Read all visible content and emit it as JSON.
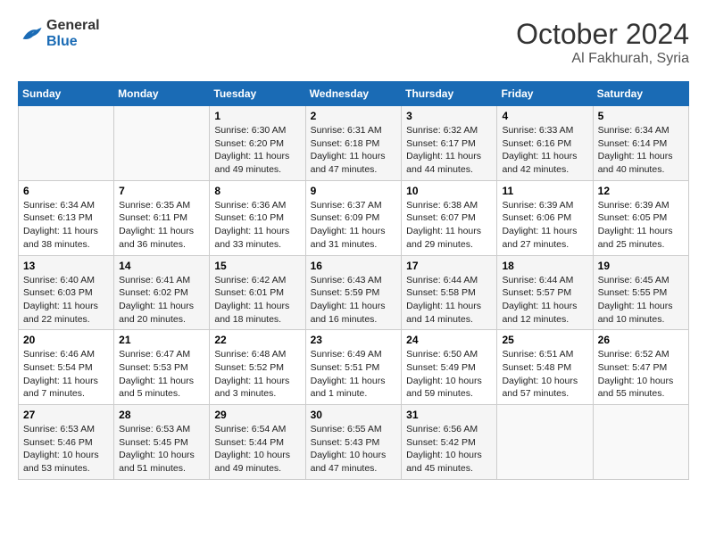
{
  "header": {
    "logo_line1": "General",
    "logo_line2": "Blue",
    "month": "October 2024",
    "location": "Al Fakhurah, Syria"
  },
  "weekdays": [
    "Sunday",
    "Monday",
    "Tuesday",
    "Wednesday",
    "Thursday",
    "Friday",
    "Saturday"
  ],
  "weeks": [
    [
      {
        "day": "",
        "info": ""
      },
      {
        "day": "",
        "info": ""
      },
      {
        "day": "1",
        "info": "Sunrise: 6:30 AM\nSunset: 6:20 PM\nDaylight: 11 hours and 49 minutes."
      },
      {
        "day": "2",
        "info": "Sunrise: 6:31 AM\nSunset: 6:18 PM\nDaylight: 11 hours and 47 minutes."
      },
      {
        "day": "3",
        "info": "Sunrise: 6:32 AM\nSunset: 6:17 PM\nDaylight: 11 hours and 44 minutes."
      },
      {
        "day": "4",
        "info": "Sunrise: 6:33 AM\nSunset: 6:16 PM\nDaylight: 11 hours and 42 minutes."
      },
      {
        "day": "5",
        "info": "Sunrise: 6:34 AM\nSunset: 6:14 PM\nDaylight: 11 hours and 40 minutes."
      }
    ],
    [
      {
        "day": "6",
        "info": "Sunrise: 6:34 AM\nSunset: 6:13 PM\nDaylight: 11 hours and 38 minutes."
      },
      {
        "day": "7",
        "info": "Sunrise: 6:35 AM\nSunset: 6:11 PM\nDaylight: 11 hours and 36 minutes."
      },
      {
        "day": "8",
        "info": "Sunrise: 6:36 AM\nSunset: 6:10 PM\nDaylight: 11 hours and 33 minutes."
      },
      {
        "day": "9",
        "info": "Sunrise: 6:37 AM\nSunset: 6:09 PM\nDaylight: 11 hours and 31 minutes."
      },
      {
        "day": "10",
        "info": "Sunrise: 6:38 AM\nSunset: 6:07 PM\nDaylight: 11 hours and 29 minutes."
      },
      {
        "day": "11",
        "info": "Sunrise: 6:39 AM\nSunset: 6:06 PM\nDaylight: 11 hours and 27 minutes."
      },
      {
        "day": "12",
        "info": "Sunrise: 6:39 AM\nSunset: 6:05 PM\nDaylight: 11 hours and 25 minutes."
      }
    ],
    [
      {
        "day": "13",
        "info": "Sunrise: 6:40 AM\nSunset: 6:03 PM\nDaylight: 11 hours and 22 minutes."
      },
      {
        "day": "14",
        "info": "Sunrise: 6:41 AM\nSunset: 6:02 PM\nDaylight: 11 hours and 20 minutes."
      },
      {
        "day": "15",
        "info": "Sunrise: 6:42 AM\nSunset: 6:01 PM\nDaylight: 11 hours and 18 minutes."
      },
      {
        "day": "16",
        "info": "Sunrise: 6:43 AM\nSunset: 5:59 PM\nDaylight: 11 hours and 16 minutes."
      },
      {
        "day": "17",
        "info": "Sunrise: 6:44 AM\nSunset: 5:58 PM\nDaylight: 11 hours and 14 minutes."
      },
      {
        "day": "18",
        "info": "Sunrise: 6:44 AM\nSunset: 5:57 PM\nDaylight: 11 hours and 12 minutes."
      },
      {
        "day": "19",
        "info": "Sunrise: 6:45 AM\nSunset: 5:55 PM\nDaylight: 11 hours and 10 minutes."
      }
    ],
    [
      {
        "day": "20",
        "info": "Sunrise: 6:46 AM\nSunset: 5:54 PM\nDaylight: 11 hours and 7 minutes."
      },
      {
        "day": "21",
        "info": "Sunrise: 6:47 AM\nSunset: 5:53 PM\nDaylight: 11 hours and 5 minutes."
      },
      {
        "day": "22",
        "info": "Sunrise: 6:48 AM\nSunset: 5:52 PM\nDaylight: 11 hours and 3 minutes."
      },
      {
        "day": "23",
        "info": "Sunrise: 6:49 AM\nSunset: 5:51 PM\nDaylight: 11 hours and 1 minute."
      },
      {
        "day": "24",
        "info": "Sunrise: 6:50 AM\nSunset: 5:49 PM\nDaylight: 10 hours and 59 minutes."
      },
      {
        "day": "25",
        "info": "Sunrise: 6:51 AM\nSunset: 5:48 PM\nDaylight: 10 hours and 57 minutes."
      },
      {
        "day": "26",
        "info": "Sunrise: 6:52 AM\nSunset: 5:47 PM\nDaylight: 10 hours and 55 minutes."
      }
    ],
    [
      {
        "day": "27",
        "info": "Sunrise: 6:53 AM\nSunset: 5:46 PM\nDaylight: 10 hours and 53 minutes."
      },
      {
        "day": "28",
        "info": "Sunrise: 6:53 AM\nSunset: 5:45 PM\nDaylight: 10 hours and 51 minutes."
      },
      {
        "day": "29",
        "info": "Sunrise: 6:54 AM\nSunset: 5:44 PM\nDaylight: 10 hours and 49 minutes."
      },
      {
        "day": "30",
        "info": "Sunrise: 6:55 AM\nSunset: 5:43 PM\nDaylight: 10 hours and 47 minutes."
      },
      {
        "day": "31",
        "info": "Sunrise: 6:56 AM\nSunset: 5:42 PM\nDaylight: 10 hours and 45 minutes."
      },
      {
        "day": "",
        "info": ""
      },
      {
        "day": "",
        "info": ""
      }
    ]
  ]
}
